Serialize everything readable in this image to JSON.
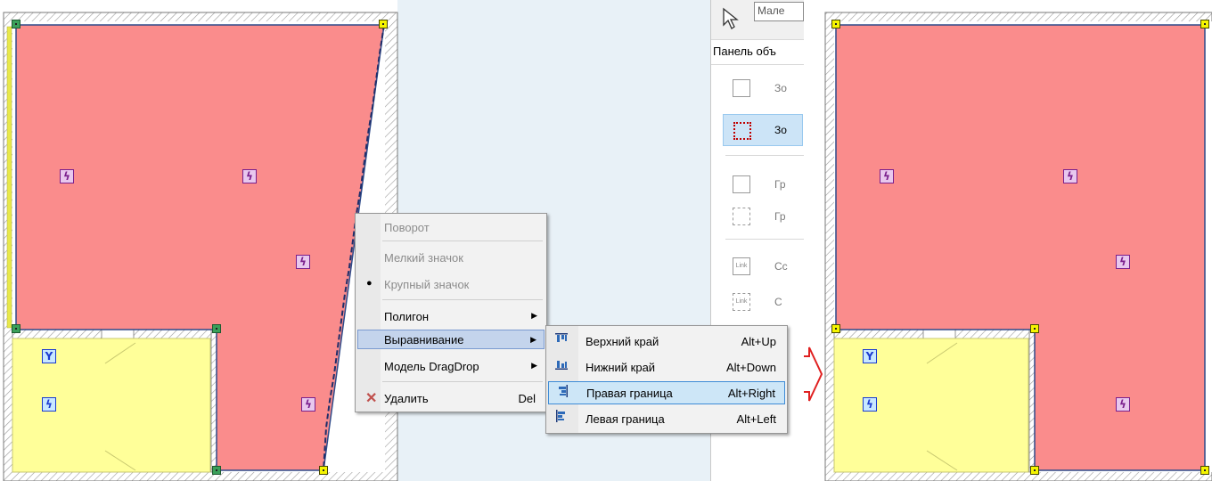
{
  "canvas": {
    "zone_red_color": "#fa8c8c",
    "zone_yellow_color": "#ffff99",
    "wall_color": "#cfcfcf",
    "panel_bg": "#e8f1f7"
  },
  "panel": {
    "search_placeholder": "Мале",
    "title": "Панель объ",
    "items": [
      {
        "label": "Зо",
        "selected": false
      },
      {
        "label": "Зо",
        "selected": true
      },
      {
        "label": "Гр",
        "selected": false
      },
      {
        "label": "Гр",
        "selected": false
      },
      {
        "label": "Сс",
        "selected": false
      },
      {
        "label": "С",
        "selected": false
      }
    ]
  },
  "context_menu": {
    "items": [
      {
        "label": "Поворот",
        "disabled": true
      },
      {
        "label": "Мелкий значок",
        "disabled": true
      },
      {
        "label": "Крупный значок",
        "disabled": true,
        "checked": true
      },
      {
        "label": "Полигон",
        "submenu": true
      },
      {
        "label": "Выравнивание",
        "submenu": true,
        "highlighted": true
      },
      {
        "label": "Модель DragDrop",
        "submenu": true
      },
      {
        "label": "Удалить",
        "shortcut": "Del",
        "icon": "delete-x-icon"
      }
    ]
  },
  "submenu": {
    "items": [
      {
        "label": "Верхний край",
        "shortcut": "Alt+Up",
        "icon": "align-top-icon"
      },
      {
        "label": "Нижний край",
        "shortcut": "Alt+Down",
        "icon": "align-bottom-icon"
      },
      {
        "label": "Правая граница",
        "shortcut": "Alt+Right",
        "icon": "align-right-icon",
        "highlighted": true
      },
      {
        "label": "Левая граница",
        "shortcut": "Alt+Left",
        "icon": "align-left-icon"
      }
    ]
  },
  "icons": {
    "stairs": "stairs-icon",
    "fork": "fork-icon",
    "arrow": "red-arrow-right-icon"
  }
}
